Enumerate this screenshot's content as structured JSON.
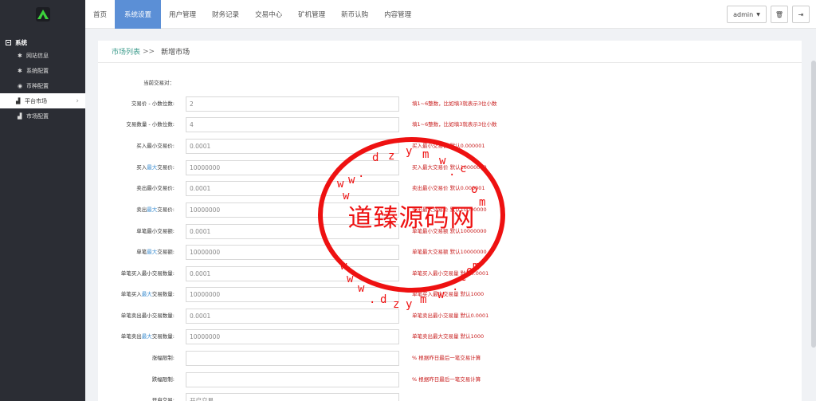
{
  "sidebar": {
    "group_label": "系统",
    "items": [
      {
        "icon": "gear-icon",
        "glyph": "✱",
        "label": "网站信息"
      },
      {
        "icon": "gear-icon",
        "glyph": "✱",
        "label": "系统配置"
      },
      {
        "icon": "coin-icon",
        "glyph": "◉",
        "label": "币种配置"
      },
      {
        "icon": "bar-chart-icon",
        "glyph": "▟",
        "label": "平台市场",
        "active": true
      },
      {
        "icon": "bar-chart-icon",
        "glyph": "▟",
        "label": "市场配置"
      }
    ]
  },
  "topnav": {
    "items": [
      "首页",
      "系统设置",
      "用户管理",
      "财务记录",
      "交易中心",
      "矿机管理",
      "新币认购",
      "内容管理"
    ],
    "active_index": 1,
    "user_label": "admin",
    "trash_glyph": "🗑",
    "logout_glyph": "⇥"
  },
  "breadcrumb": {
    "link": "市场列表",
    "sep": ">>",
    "current": "新增市场"
  },
  "form": {
    "rows": [
      {
        "pre": "当前交易对：",
        "hl": "",
        "post": "",
        "value": "",
        "hint": "",
        "has_input": false
      },
      {
        "pre": "交易价 - 小数位数:",
        "hl": "",
        "post": "",
        "value": "2",
        "hint": "填1~6整数，比如填3就表示3位小数",
        "has_input": true
      },
      {
        "pre": "交易数量 - 小数位数:",
        "hl": "",
        "post": "",
        "value": "4",
        "hint": "填1~6整数，比如填3就表示3位小数",
        "has_input": true
      },
      {
        "pre": "买入最小交易价:",
        "hl": "",
        "post": "",
        "value": "0.0001",
        "hint": "买入最小交易价 默认0.000001",
        "has_input": true
      },
      {
        "pre": "买入",
        "hl": "最大",
        "post": "交易价:",
        "value": "10000000",
        "hint": "买入最大交易价 默认10000000",
        "has_input": true
      },
      {
        "pre": "卖出最小交易价:",
        "hl": "",
        "post": "",
        "value": "0.0001",
        "hint": "卖出最小交易价 默认0.000001",
        "has_input": true
      },
      {
        "pre": "卖出",
        "hl": "最大",
        "post": "交易价:",
        "value": "10000000",
        "hint": "卖出最大交易价 默认10000000",
        "has_input": true
      },
      {
        "pre": "单笔最小交易额:",
        "hl": "",
        "post": "",
        "value": "0.0001",
        "hint": "单笔最小交易额 默认10000000",
        "has_input": true
      },
      {
        "pre": "单笔",
        "hl": "最大",
        "post": "交易额:",
        "value": "10000000",
        "hint": "单笔最大交易额 默认10000000",
        "has_input": true
      },
      {
        "pre": "单笔买入最小交易数量:",
        "hl": "",
        "post": "",
        "value": "0.0001",
        "hint": "单笔买入最小交易量 默认0.0001",
        "has_input": true
      },
      {
        "pre": "单笔买入",
        "hl": "最大",
        "post": "交易数量:",
        "value": "10000000",
        "hint": "单笔买入最大交易量 默认1000",
        "has_input": true
      },
      {
        "pre": "单笔卖出最小交易数量:",
        "hl": "",
        "post": "",
        "value": "0.0001",
        "hint": "单笔卖出最小交易量 默认0.0001",
        "has_input": true
      },
      {
        "pre": "单笔卖出",
        "hl": "最大",
        "post": "交易数量:",
        "value": "10000000",
        "hint": "单笔卖出最大交易量 默认1000",
        "has_input": true
      },
      {
        "pre": "涨幅限制:",
        "hl": "",
        "post": "",
        "value": "",
        "hint": "% 根据昨日最后一笔交易计算",
        "has_input": true
      },
      {
        "pre": "跌幅限制:",
        "hl": "",
        "post": "",
        "value": "",
        "hint": "% 根据昨日最后一笔交易计算",
        "has_input": true
      },
      {
        "pre": "开启交易:",
        "hl": "",
        "post": "",
        "value": "开启交易",
        "hint": "",
        "has_input": true
      }
    ]
  },
  "watermark": {
    "title": "道臻源码网",
    "chars": [
      "w",
      "w",
      "w",
      ".",
      "d",
      "z",
      "y",
      "m",
      "w",
      ".",
      "c",
      "o",
      "m",
      "w",
      "w",
      "w",
      ".",
      "d",
      "z",
      "y",
      "m",
      "w",
      ".",
      "c",
      "o",
      "m"
    ]
  }
}
